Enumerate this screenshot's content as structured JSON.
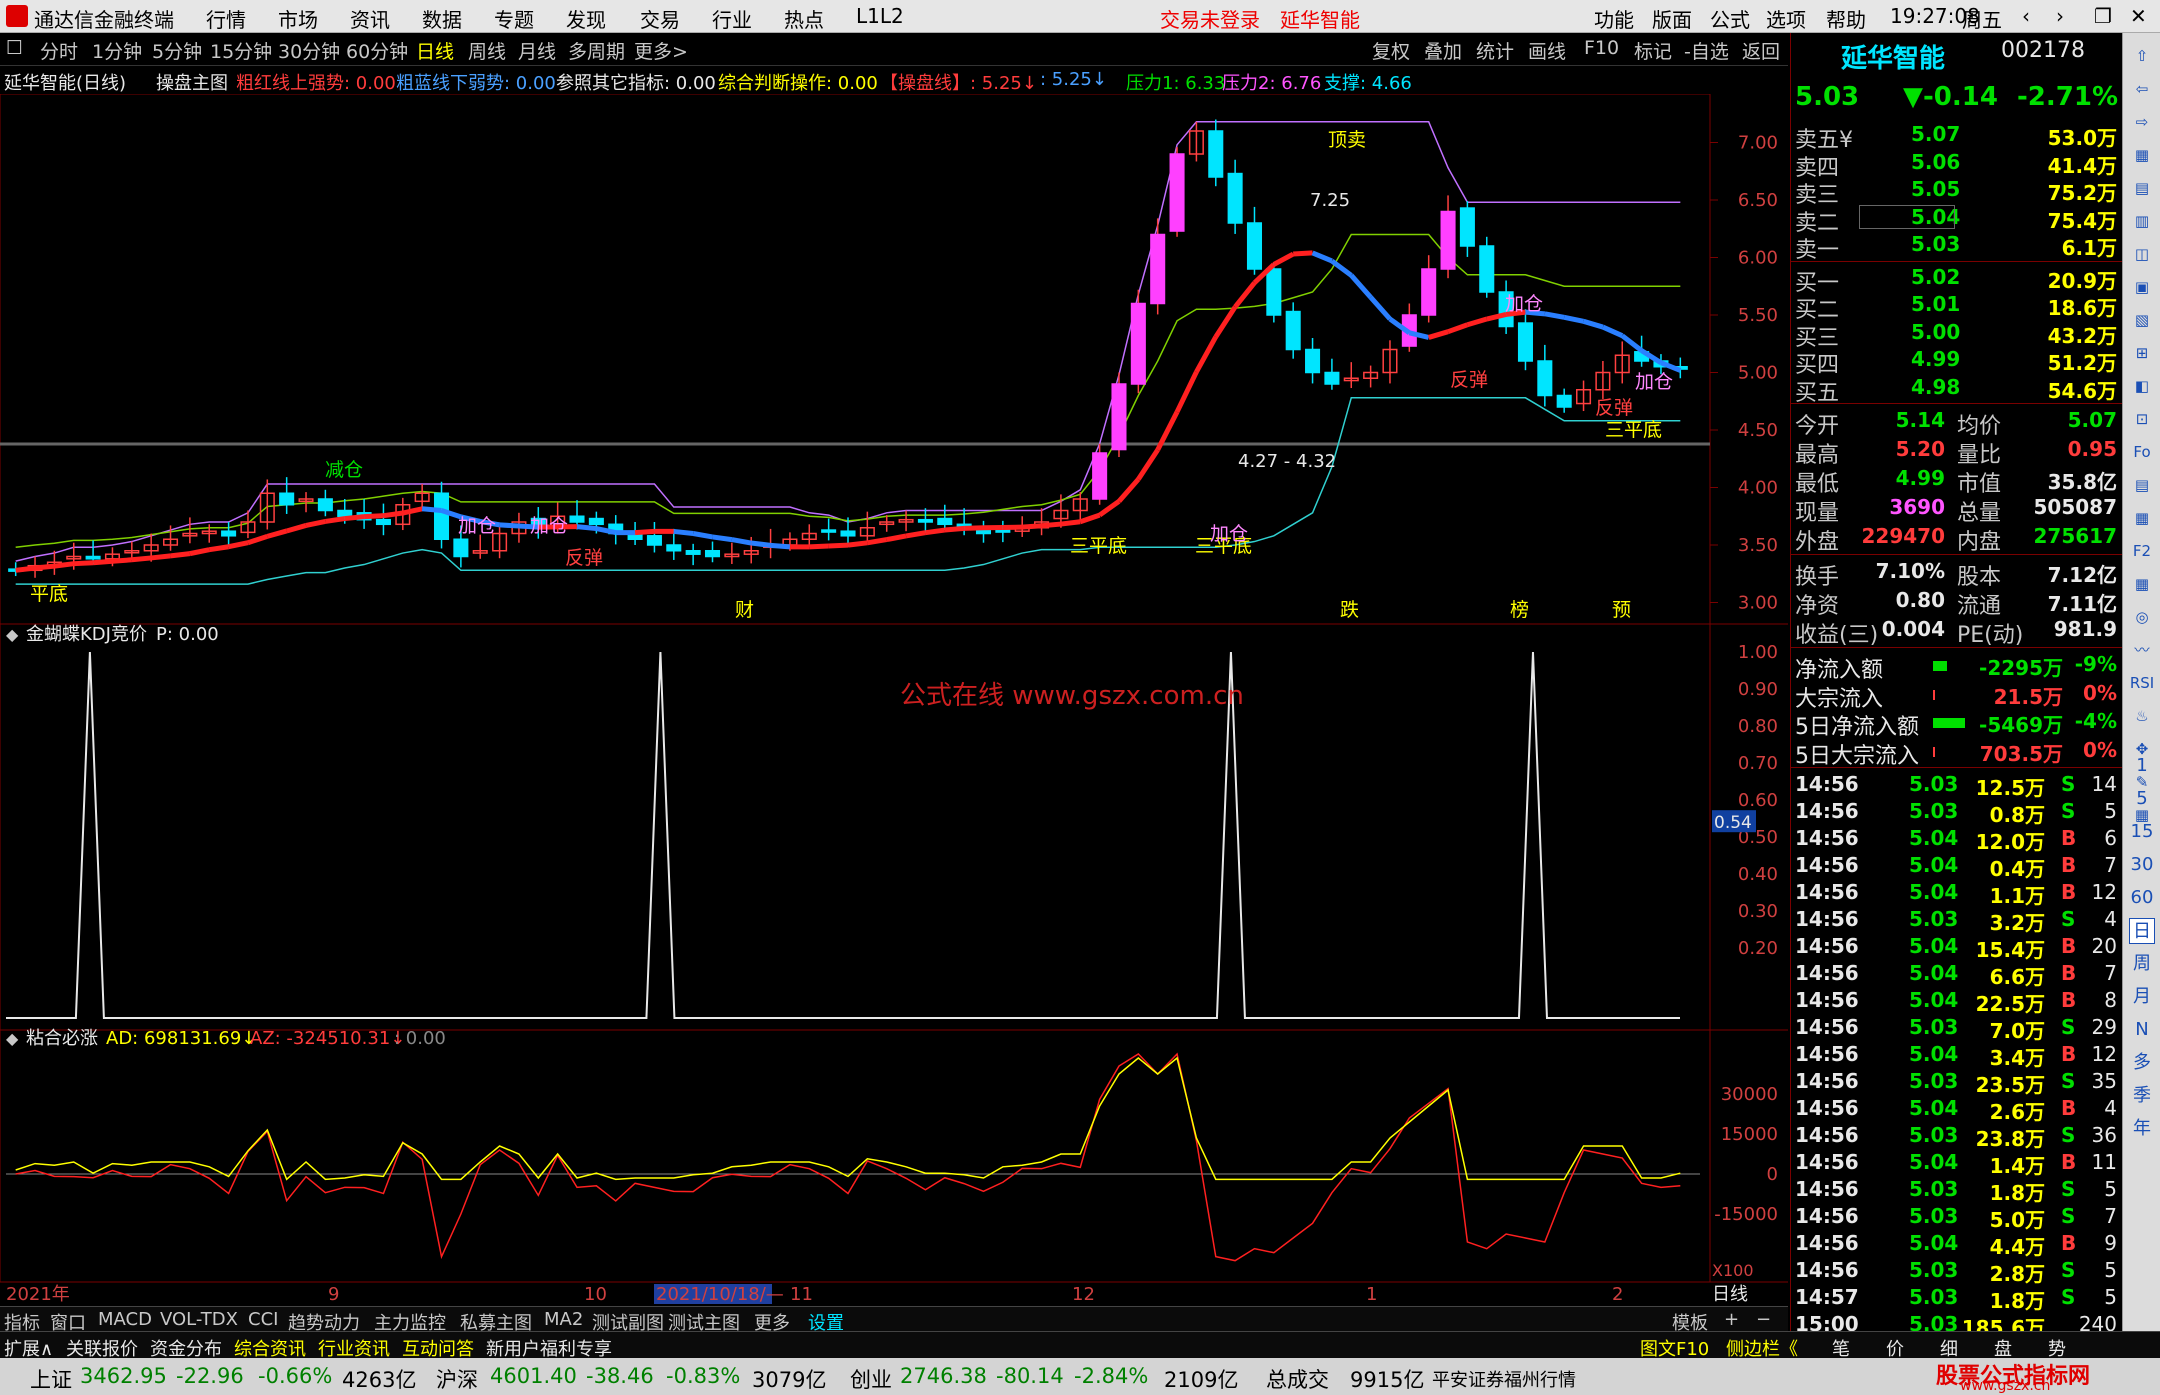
{
  "titlebar": {
    "app_name": "通达信金融终端",
    "menu": [
      "行情",
      "市场",
      "资讯",
      "数据",
      "专题",
      "发现",
      "交易",
      "行业",
      "热点",
      "L1L2"
    ],
    "login_status": "交易未登录",
    "stock_name": "延华智能",
    "right_menu": [
      "功能",
      "版面",
      "公式",
      "选项",
      "帮助"
    ],
    "time": "19:27:08",
    "weekday": "周五"
  },
  "toolbar": {
    "periods": [
      "分时",
      "1分钟",
      "5分钟",
      "15分钟",
      "30分钟",
      "60分钟",
      "日线",
      "周线",
      "月线",
      "多周期",
      "更多>"
    ],
    "active_period": "日线",
    "buttons": [
      "复权",
      "叠加",
      "统计",
      "画线",
      "F10",
      "标记",
      "-自选",
      "返回"
    ]
  },
  "indicator_line": {
    "title": "延华智能(日线)",
    "main": "操盘主图",
    "items": [
      {
        "label": "粗红线上强势: 0.00",
        "color": "#ff3c3c"
      },
      {
        "label": "粗蓝线下弱势: 0.00",
        "color": "#4aa0ff"
      },
      {
        "label": "参照其它指标: 0.00",
        "color": "#e8e8e8"
      },
      {
        "label": "综合判断操作: 0.00",
        "color": "#ffff00"
      },
      {
        "label": "【操盘线】: 5.25↓",
        "color": "#ff3c3c"
      },
      {
        "label": ": 5.25↓",
        "color": "#4aa0ff"
      },
      {
        "label": "压力1: 6.33",
        "color": "#00e000"
      },
      {
        "label": "压力2: 6.76",
        "color": "#ff55ff"
      },
      {
        "label": "支撑: 4.66",
        "color": "#00e5ff"
      }
    ]
  },
  "chart_data": [
    {
      "type": "candlestick",
      "title": "延华智能(日线)",
      "ylim": [
        2.9,
        7.3
      ],
      "y_ticks": [
        "7.00",
        "6.50",
        "6.00",
        "5.50",
        "5.00",
        "4.50",
        "4.00",
        "3.50",
        "3.00"
      ],
      "high_label": "7.25",
      "range_label": "4.27 - 4.32",
      "annotations": [
        "平底",
        "减仓",
        "加仓",
        "加仓",
        "反弹",
        "三平底",
        "三平底",
        "加仓",
        "顶卖",
        "加仓",
        "反弹",
        "加仓",
        "三平底",
        "反弹"
      ],
      "event_markers": [
        "财",
        "跌",
        "榜",
        "预"
      ],
      "close_series_approx": [
        3.28,
        3.32,
        3.35,
        3.4,
        3.38,
        3.42,
        3.45,
        3.5,
        3.55,
        3.6,
        3.62,
        3.58,
        3.7,
        3.95,
        3.85,
        3.9,
        3.8,
        3.75,
        3.72,
        3.68,
        3.85,
        3.95,
        3.55,
        3.4,
        3.45,
        3.6,
        3.7,
        3.65,
        3.75,
        3.7,
        3.68,
        3.6,
        3.55,
        3.5,
        3.45,
        3.42,
        3.4,
        3.42,
        3.45,
        3.5,
        3.55,
        3.6,
        3.62,
        3.58,
        3.65,
        3.7,
        3.72,
        3.7,
        3.68,
        3.65,
        3.6,
        3.62,
        3.65,
        3.7,
        3.8,
        3.9,
        4.3,
        4.9,
        5.6,
        6.2,
        6.9,
        7.1,
        6.7,
        6.3,
        5.9,
        5.5,
        5.2,
        5.0,
        4.9,
        4.95,
        5.0,
        5.2,
        5.5,
        5.9,
        6.4,
        6.1,
        5.7,
        5.4,
        5.1,
        4.8,
        4.7,
        4.85,
        5.0,
        5.15,
        5.1,
        5.05,
        5.03
      ]
    },
    {
      "type": "line",
      "title": "金蝴蝶KDJ竞价",
      "value_label": "P: 0.00",
      "ylim": [
        0,
        1
      ],
      "y_ticks": [
        "1.00",
        "0.90",
        "0.80",
        "0.70",
        "0.60",
        "0.50",
        "0.40",
        "0.30",
        "0.20"
      ],
      "current_value": "0.54",
      "spikes_at_fraction": [
        0.05,
        0.39,
        0.73,
        0.91
      ]
    },
    {
      "type": "line",
      "title": "粘合必涨",
      "series": [
        {
          "name": "AD",
          "label": "AD: 698131.69↓",
          "color": "#ffff00"
        },
        {
          "name": "AZ",
          "label": "AZ: -324510.31↓",
          "color": "#ff3c3c"
        }
      ],
      "extra_label": ": 0.00",
      "y_ticks": [
        "30000",
        "15000",
        "0",
        "-15000"
      ],
      "multiplier": "X100"
    }
  ],
  "x_axis": {
    "labels": [
      "2021年",
      "9",
      "10",
      "2021/10/18/—",
      "11",
      "12",
      "1",
      "2",
      "日线"
    ]
  },
  "watermark": "公式在线 www.gszx.com.cn",
  "right_panel": {
    "name": "延华智能",
    "code": "002178",
    "price": "5.03",
    "change": "▼-0.14",
    "pct": "-2.71%",
    "sells": [
      {
        "label": "卖五¥",
        "price": "5.07",
        "vol": "53.0万"
      },
      {
        "label": "卖四",
        "price": "5.06",
        "vol": "41.4万"
      },
      {
        "label": "卖三",
        "price": "5.05",
        "vol": "75.2万"
      },
      {
        "label": "卖二",
        "price": "5.04",
        "vol": "75.4万"
      },
      {
        "label": "卖一",
        "price": "5.03",
        "vol": "6.1万"
      }
    ],
    "buys": [
      {
        "label": "买一",
        "price": "5.02",
        "vol": "20.9万"
      },
      {
        "label": "买二",
        "price": "5.01",
        "vol": "18.6万"
      },
      {
        "label": "买三",
        "price": "5.00",
        "vol": "43.2万"
      },
      {
        "label": "买四",
        "price": "4.99",
        "vol": "51.2万"
      },
      {
        "label": "买五",
        "price": "4.98",
        "vol": "54.6万"
      }
    ],
    "stats": [
      {
        "l1": "今开",
        "v1": "5.14",
        "l2": "均价",
        "v2": "5.07"
      },
      {
        "l1": "最高",
        "v1": "5.20",
        "l2": "量比",
        "v2": "0.95"
      },
      {
        "l1": "最低",
        "v1": "4.99",
        "l2": "市值",
        "v2": "35.8亿"
      },
      {
        "l1": "现量",
        "v1": "3690",
        "l2": "总量",
        "v2": "505087"
      },
      {
        "l1": "外盘",
        "v1": "229470",
        "l2": "内盘",
        "v2": "275617"
      }
    ],
    "stats2": [
      {
        "l1": "换手",
        "v1": "7.10%",
        "l2": "股本",
        "v2": "7.12亿"
      },
      {
        "l1": "净资",
        "v1": "0.80",
        "l2": "流通",
        "v2": "7.11亿"
      },
      {
        "l1": "收益(三)",
        "v1": "0.004",
        "l2": "PE(动)",
        "v2": "981.9"
      }
    ],
    "flows": [
      {
        "label": "净流入额",
        "value": "-2295万",
        "pct": "-9%"
      },
      {
        "label": "大宗流入",
        "value": "21.5万",
        "pct": "0%"
      },
      {
        "label": "5日净流入额",
        "value": "-5469万",
        "pct": "-4%"
      },
      {
        "label": "5日大宗流入",
        "value": "703.5万",
        "pct": "0%"
      }
    ],
    "ticks": [
      [
        "14:56",
        "5.03",
        "12.5万",
        "S",
        "14"
      ],
      [
        "14:56",
        "5.03",
        "0.8万",
        "S",
        "5"
      ],
      [
        "14:56",
        "5.04",
        "12.0万",
        "B",
        "6"
      ],
      [
        "14:56",
        "5.04",
        "0.4万",
        "B",
        "7"
      ],
      [
        "14:56",
        "5.04",
        "1.1万",
        "B",
        "12"
      ],
      [
        "14:56",
        "5.03",
        "3.2万",
        "S",
        "4"
      ],
      [
        "14:56",
        "5.04",
        "15.4万",
        "B",
        "20"
      ],
      [
        "14:56",
        "5.04",
        "6.6万",
        "B",
        "7"
      ],
      [
        "14:56",
        "5.04",
        "22.5万",
        "B",
        "8"
      ],
      [
        "14:56",
        "5.03",
        "7.0万",
        "S",
        "29"
      ],
      [
        "14:56",
        "5.04",
        "3.4万",
        "B",
        "12"
      ],
      [
        "14:56",
        "5.03",
        "23.5万",
        "S",
        "35"
      ],
      [
        "14:56",
        "5.04",
        "2.6万",
        "B",
        "4"
      ],
      [
        "14:56",
        "5.03",
        "23.8万",
        "S",
        "36"
      ],
      [
        "14:56",
        "5.04",
        "1.4万",
        "B",
        "11"
      ],
      [
        "14:56",
        "5.03",
        "1.8万",
        "S",
        "5"
      ],
      [
        "14:56",
        "5.03",
        "5.0万",
        "S",
        "7"
      ],
      [
        "14:56",
        "5.04",
        "4.4万",
        "B",
        "9"
      ],
      [
        "14:56",
        "5.03",
        "2.8万",
        "S",
        "5"
      ],
      [
        "14:57",
        "5.03",
        "1.8万",
        "S",
        "5"
      ],
      [
        "15:00",
        "5.03",
        "185.6万",
        "",
        "240"
      ]
    ]
  },
  "side_icons": [
    "1",
    "5",
    "15",
    "30",
    "60",
    "日",
    "周",
    "月",
    "N",
    "多",
    "季",
    "年"
  ],
  "bottom_tabs": [
    "指标",
    "窗口",
    "MACD",
    "VOL-TDX",
    "CCI",
    "趋势动力",
    "主力监控",
    "私募主图",
    "MA2",
    "测试副图",
    "测试主图",
    "更多",
    "设置",
    "模板",
    "+",
    "−"
  ],
  "ext_bar": {
    "items": [
      "扩展∧",
      "关联报价",
      "资金分布",
      "综合资讯",
      "行业资讯",
      "互动问答",
      "新用户福利专享"
    ],
    "right_items": [
      "图文F10",
      "侧边栏《",
      "笔",
      "价",
      "细",
      "盘",
      "势"
    ]
  },
  "status_bar": {
    "sh": {
      "name": "上证",
      "val": "3462.95",
      "chg": "-22.96",
      "pct": "-0.66%",
      "amt": "4263亿"
    },
    "sz": {
      "name": "沪深",
      "val": "4601.40",
      "chg": "-38.46",
      "pct": "-0.83%",
      "amt": "3079亿"
    },
    "cy": {
      "name": "创业",
      "val": "2746.38",
      "chg": "-80.14",
      "pct": "-2.84%",
      "amt": "2109亿"
    },
    "total_label": "总成交",
    "total": "9915亿",
    "broker": "平安证券福州行情",
    "logo": "股票公式指标网",
    "logo_url": "www.gszx.cn"
  }
}
